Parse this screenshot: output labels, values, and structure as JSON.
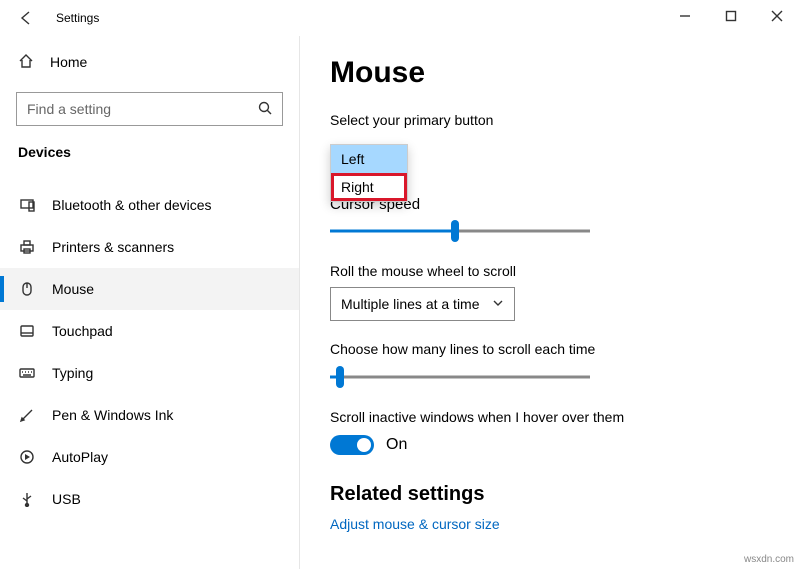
{
  "window": {
    "title": "Settings"
  },
  "sidebar": {
    "home": "Home",
    "search_placeholder": "Find a setting",
    "section": "Devices",
    "items": [
      {
        "label": "Bluetooth & other devices"
      },
      {
        "label": "Printers & scanners"
      },
      {
        "label": "Mouse"
      },
      {
        "label": "Touchpad"
      },
      {
        "label": "Typing"
      },
      {
        "label": "Pen & Windows Ink"
      },
      {
        "label": "AutoPlay"
      },
      {
        "label": "USB"
      }
    ]
  },
  "page": {
    "heading": "Mouse",
    "primary_label": "Select your primary button",
    "primary_options": {
      "left": "Left",
      "right": "Right"
    },
    "cursor_speed_label": "Cursor speed",
    "roll_label": "Roll the mouse wheel to scroll",
    "roll_value": "Multiple lines at a time",
    "lines_label": "Choose how many lines to scroll each time",
    "inactive_label": "Scroll inactive windows when I hover over them",
    "inactive_value": "On",
    "related_heading": "Related settings",
    "related_link": "Adjust mouse & cursor size"
  },
  "watermark": "wsxdn.com"
}
